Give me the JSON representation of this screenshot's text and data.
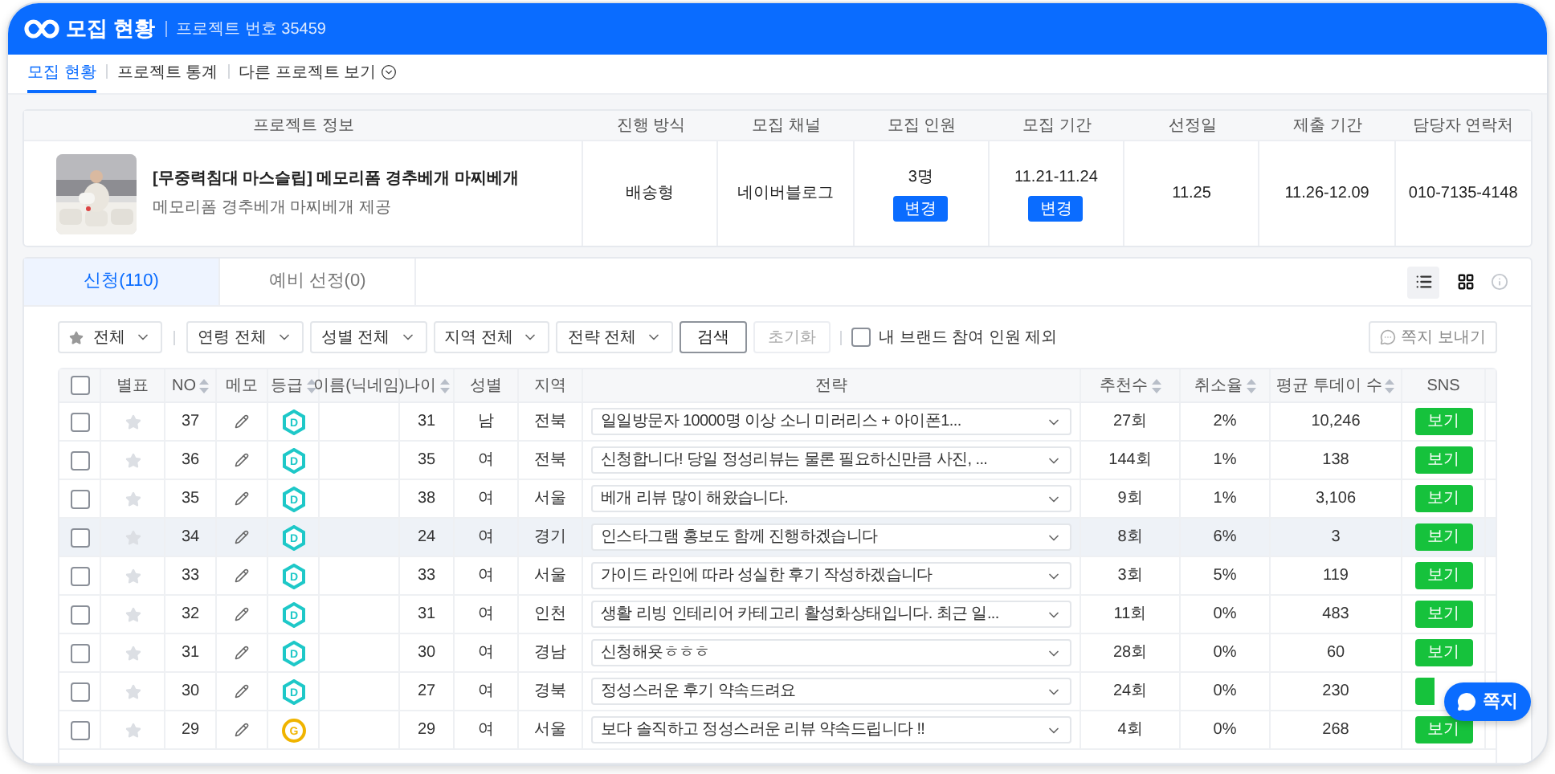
{
  "header": {
    "title": "모집 현황",
    "project_number": "프로젝트 번호 35459"
  },
  "nav_tabs": [
    {
      "label": "모집 현황",
      "selected": true
    },
    {
      "label": "프로젝트 통계",
      "selected": false
    },
    {
      "label": "다른 프로젝트 보기",
      "selected": false,
      "dropdown": true
    }
  ],
  "project_info": {
    "columns": [
      "프로젝트 정보",
      "진행 방식",
      "모집 채널",
      "모집 인원",
      "모집 기간",
      "선정일",
      "제출 기간",
      "담당자 연락처"
    ],
    "title": "[무중력침대 마스슬립] 메모리폼 경추베개 마찌베개",
    "subtitle": "메모리폼 경추베개 마찌베개 제공",
    "method": "배송형",
    "channel": "네이버블로그",
    "headcount": "3명",
    "headcount_button": "변경",
    "period": "11.21-11.24",
    "period_button": "변경",
    "selection_date": "11.25",
    "submission_period": "11.26-12.09",
    "contact": "010-7135-4148"
  },
  "list_tabs": [
    {
      "label": "신청(110)",
      "selected": true
    },
    {
      "label": "예비 선정(0)",
      "selected": false
    }
  ],
  "view_modes": [
    {
      "kind": "list",
      "selected": true
    },
    {
      "kind": "grid",
      "selected": false
    }
  ],
  "filters": [
    {
      "kind": "star",
      "label": "전체"
    },
    {
      "kind": "select",
      "label": "연령 전체"
    },
    {
      "kind": "select",
      "label": "성별 전체"
    },
    {
      "kind": "select",
      "label": "지역 전체"
    },
    {
      "kind": "select",
      "label": "전략 전체"
    }
  ],
  "search_button": "검색",
  "reset_button": "초기화",
  "exclude_option": {
    "label": "내 브랜드 참여 인원 제외",
    "checked": false
  },
  "message_button": "쪽지 보내기",
  "table": {
    "all_checked": false,
    "columns": [
      {
        "label": "별표",
        "sortable": false
      },
      {
        "label": "NO",
        "sortable": true
      },
      {
        "label": "메모",
        "sortable": false
      },
      {
        "label": "등급",
        "sortable": true
      },
      {
        "label": "이름(닉네임)",
        "sortable": false
      },
      {
        "label": "나이",
        "sortable": true
      },
      {
        "label": "성별",
        "sortable": false
      },
      {
        "label": "지역",
        "sortable": false
      },
      {
        "label": "전략",
        "sortable": false
      },
      {
        "label": "추천수",
        "sortable": true
      },
      {
        "label": "취소율",
        "sortable": true
      },
      {
        "label": "평균 투데이 수",
        "sortable": true
      },
      {
        "label": "SNS",
        "sortable": false
      }
    ],
    "rows": [
      {
        "checked": false,
        "starred": false,
        "hovered": false,
        "no": "37",
        "grade": {
          "letter": "D",
          "kind": "hexagon",
          "color": "#1ec8c8"
        },
        "age": "31",
        "gender": "남",
        "region": "전북",
        "strategy": "일일방문자 10000명 이상 소니 미러리스 + 아이폰1...",
        "recommend": "27회",
        "cancel": "2%",
        "avg_today": "10,246",
        "sns": "보기"
      },
      {
        "checked": false,
        "starred": false,
        "hovered": false,
        "no": "36",
        "grade": {
          "letter": "D",
          "kind": "hexagon",
          "color": "#1ec8c8"
        },
        "age": "35",
        "gender": "여",
        "region": "전북",
        "strategy": "신청합니다! 당일 정성리뷰는 물론 필요하신만큼 사진, ...",
        "recommend": "144회",
        "cancel": "1%",
        "avg_today": "138",
        "sns": "보기"
      },
      {
        "checked": false,
        "starred": false,
        "hovered": false,
        "no": "35",
        "grade": {
          "letter": "D",
          "kind": "hexagon",
          "color": "#1ec8c8"
        },
        "age": "38",
        "gender": "여",
        "region": "서울",
        "strategy": "베개 리뷰 많이 해왔습니다.",
        "recommend": "9회",
        "cancel": "1%",
        "avg_today": "3,106",
        "sns": "보기"
      },
      {
        "checked": false,
        "starred": false,
        "hovered": true,
        "no": "34",
        "grade": {
          "letter": "D",
          "kind": "hexagon",
          "color": "#1ec8c8"
        },
        "age": "24",
        "gender": "여",
        "region": "경기",
        "strategy": "인스타그램 홍보도 함께 진행하겠습니다",
        "recommend": "8회",
        "cancel": "6%",
        "avg_today": "3",
        "sns": "보기"
      },
      {
        "checked": false,
        "starred": false,
        "hovered": false,
        "no": "33",
        "grade": {
          "letter": "D",
          "kind": "hexagon",
          "color": "#1ec8c8"
        },
        "age": "33",
        "gender": "여",
        "region": "서울",
        "strategy": "가이드 라인에 따라 성실한 후기 작성하겠습니다",
        "recommend": "3회",
        "cancel": "5%",
        "avg_today": "119",
        "sns": "보기"
      },
      {
        "checked": false,
        "starred": false,
        "hovered": false,
        "no": "32",
        "grade": {
          "letter": "D",
          "kind": "hexagon",
          "color": "#1ec8c8"
        },
        "age": "31",
        "gender": "여",
        "region": "인천",
        "strategy": "생활 리빙 인테리어 카테고리 활성화상태입니다. 최근 일...",
        "recommend": "11회",
        "cancel": "0%",
        "avg_today": "483",
        "sns": "보기"
      },
      {
        "checked": false,
        "starred": false,
        "hovered": false,
        "no": "31",
        "grade": {
          "letter": "D",
          "kind": "hexagon",
          "color": "#1ec8c8"
        },
        "age": "30",
        "gender": "여",
        "region": "경남",
        "strategy": "신청해욧ㅎㅎㅎ",
        "recommend": "28회",
        "cancel": "0%",
        "avg_today": "60",
        "sns": "보기"
      },
      {
        "checked": false,
        "starred": false,
        "hovered": false,
        "no": "30",
        "grade": {
          "letter": "D",
          "kind": "hexagon",
          "color": "#1ec8c8"
        },
        "age": "27",
        "gender": "여",
        "region": "경북",
        "strategy": "정성스러운 후기 약속드려요",
        "recommend": "24회",
        "cancel": "0%",
        "avg_today": "230"
      },
      {
        "checked": false,
        "starred": false,
        "hovered": false,
        "no": "29",
        "grade": {
          "letter": "G",
          "kind": "circle",
          "color": "#f0b400"
        },
        "age": "29",
        "gender": "여",
        "region": "서울",
        "strategy": "보다 솔직하고 정성스러운 리뷰 약속드립니다 !!",
        "recommend": "4회",
        "cancel": "0%",
        "avg_today": "268",
        "sns": "보기"
      }
    ]
  },
  "chat_button": "쪽지"
}
